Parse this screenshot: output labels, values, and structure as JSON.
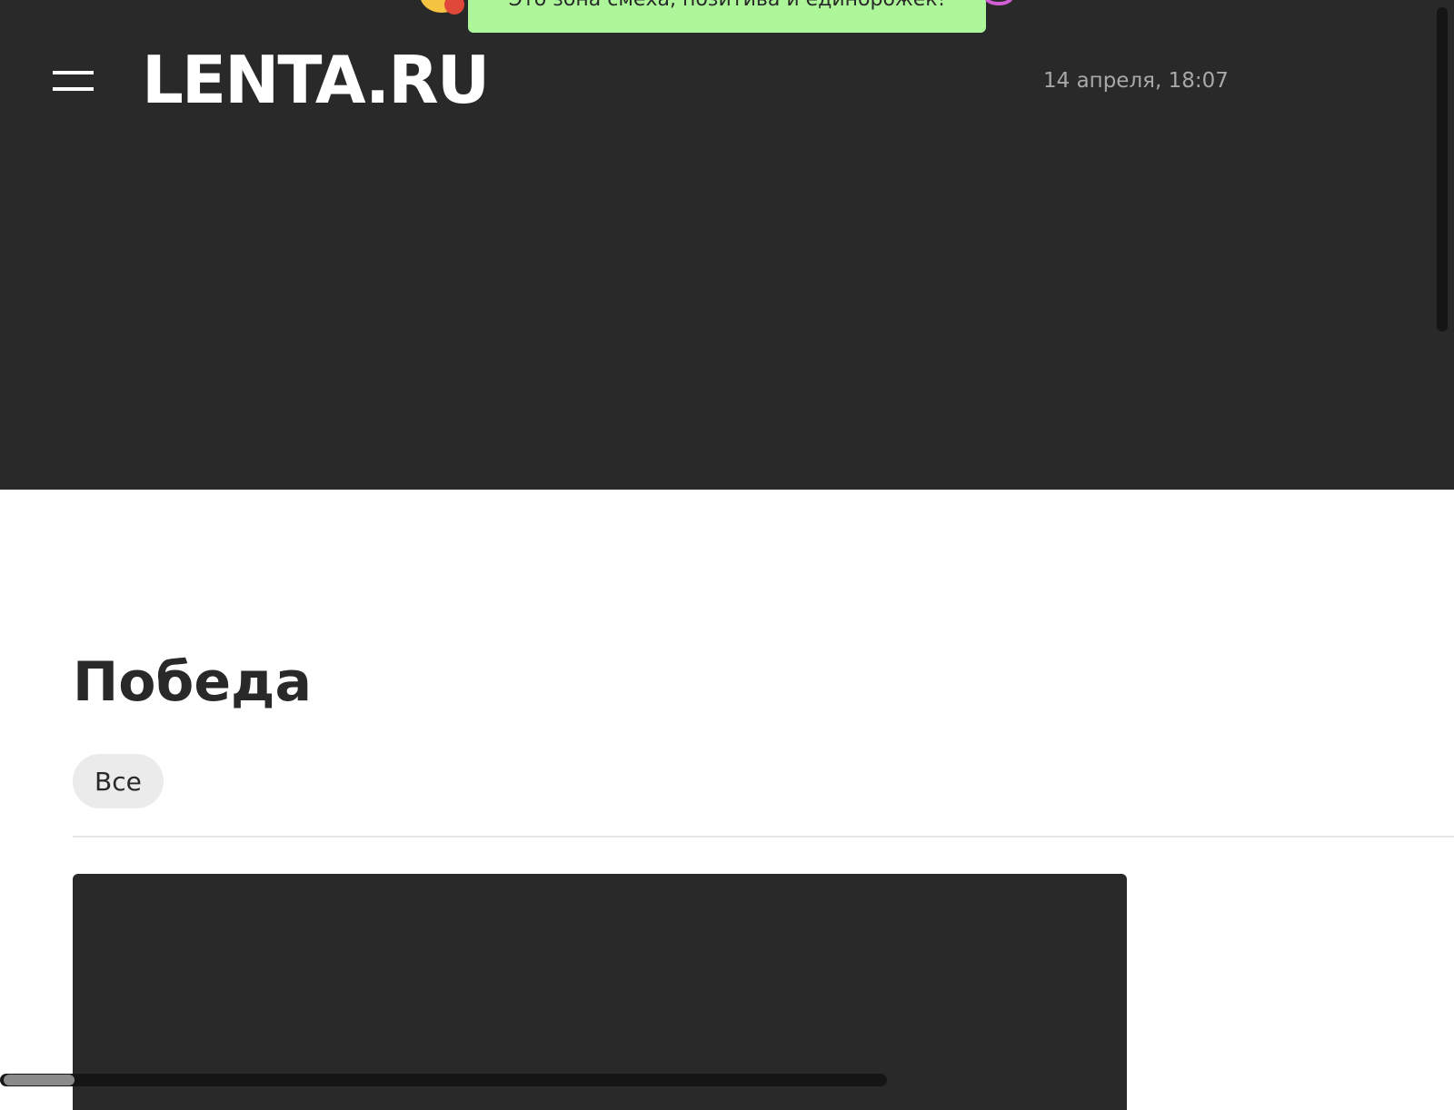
{
  "promo": {
    "text": "Это зона смеха, позитива и единорожек!"
  },
  "header": {
    "logo": "LENTA.RU",
    "datetime": "14 апреля, 18:07"
  },
  "page": {
    "title": "Победа"
  },
  "filters": {
    "items": [
      {
        "label": "Все"
      }
    ]
  },
  "colors": {
    "header_bg": "#292929",
    "promo_bg": "#adf79a",
    "chip_bg": "#ebebeb",
    "text_dark": "#292929",
    "datetime_text": "#a8a8a8"
  },
  "icons": {
    "menu": "hamburger-menu-icon"
  }
}
